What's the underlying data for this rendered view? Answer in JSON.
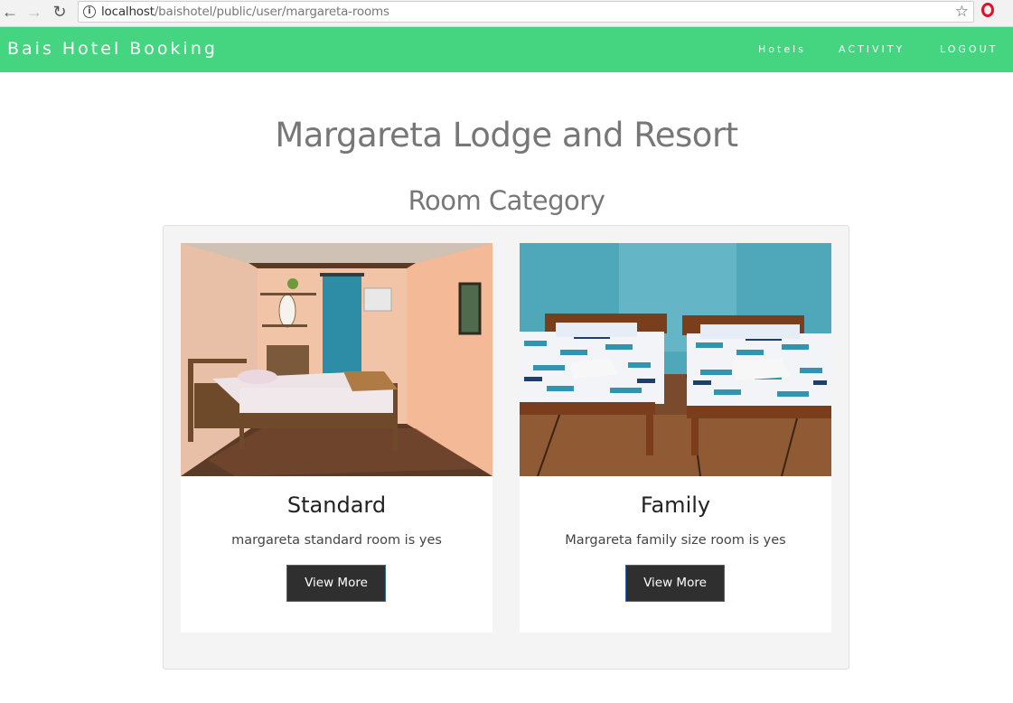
{
  "browser": {
    "url_host": "localhost",
    "url_path": "/baishotel/public/user/margareta-rooms"
  },
  "navbar": {
    "brand": "Bais Hotel Booking",
    "links": [
      "Hotels",
      "ACTIVITY",
      "LOGOUT"
    ]
  },
  "page": {
    "title": "Margareta Lodge and Resort",
    "subtitle": "Room Category"
  },
  "rooms": [
    {
      "name": "Standard",
      "description": "margareta standard room is yes",
      "button": "View More",
      "image": "room-single-bed-photo"
    },
    {
      "name": "Family",
      "description": "Margareta family size room is yes",
      "button": "View More",
      "image": "room-two-beds-photo"
    }
  ],
  "colors": {
    "navbar": "#45d480",
    "button": "#2f2f2f"
  }
}
